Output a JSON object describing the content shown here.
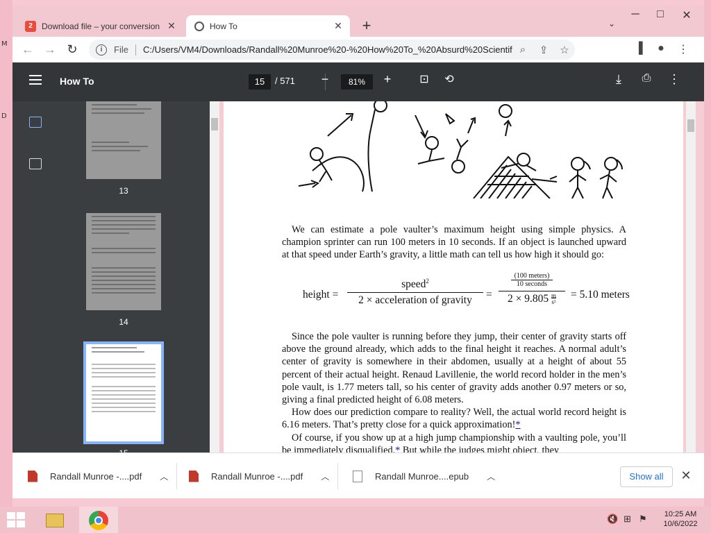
{
  "desktop": {
    "edge_left_labels": [
      "M",
      "D"
    ]
  },
  "tabs": [
    {
      "title": "Download file – your conversion",
      "favicon": "download-site-icon",
      "favicon_text": "2"
    },
    {
      "title": "How To",
      "favicon": "globe-icon",
      "active": true
    }
  ],
  "new_tab_label": "+",
  "window_controls": {
    "minimize": "─",
    "maximize": "□",
    "close": "✕"
  },
  "address_bar": {
    "scheme_label": "File",
    "url": "C:/Users/VM4/Downloads/Randall%20Munroe%20-%20How%20To_%20Absurd%20Scientific%..."
  },
  "pdf_toolbar": {
    "title": "How To",
    "current_page": "15",
    "total_pages": "/ 571",
    "zoom": "81%"
  },
  "thumbnails": [
    {
      "page": "13"
    },
    {
      "page": "14"
    },
    {
      "page": "15",
      "active": true
    }
  ],
  "page_content": {
    "para1": "We can estimate a pole vaulter’s maximum height using simple physics. A champion sprinter can run 100 meters in 10 seconds. If an object is launched upward at that speed under Earth’s gravity, a little math can tell us how high it should go:",
    "equation": {
      "lhs": "height =",
      "num1": "speed",
      "num1_exp": "2",
      "den1": "2 × acceleration of gravity",
      "eq2": "=",
      "num2_top": "100 meters",
      "num2_bottom": "10 seconds",
      "den2": "2 × 9.805",
      "den2_unit_top": "m",
      "den2_unit_bottom": "s²",
      "result": "= 5.10 meters"
    },
    "para2": "Since the pole vaulter is running before they jump, their center of gravity starts off above the ground already, which adds to the final height it reaches. A normal adult’s center of gravity is somewhere in their abdomen, usually at a height of about 55 percent of their actual height. Renaud Lavillenie, the world record holder in the men’s pole vault, is 1.77 meters tall, so his center of gravity adds another 0.97 meters or so, giving a final predicted height of 6.08 meters.",
    "para3": "How does our prediction compare to reality? Well, the actual world record height is 6.16 meters. That’s pretty close for a quick approximation!",
    "para3_link": "*",
    "para4": "Of course, if you show up at a high jump championship with a vaulting pole, you’ll be immediately disqualified.",
    "para4_link": "*",
    "para4_tail": "But while the judges might object, they"
  },
  "downloads": [
    {
      "name": "Randall Munroe -....pdf",
      "type": "pdf"
    },
    {
      "name": "Randall Munroe -....pdf",
      "type": "pdf"
    },
    {
      "name": "Randall Munroe....epub",
      "type": "epub"
    }
  ],
  "show_all_label": "Show all",
  "clock": {
    "time": "10:25 AM",
    "date": "10/6/2022"
  }
}
